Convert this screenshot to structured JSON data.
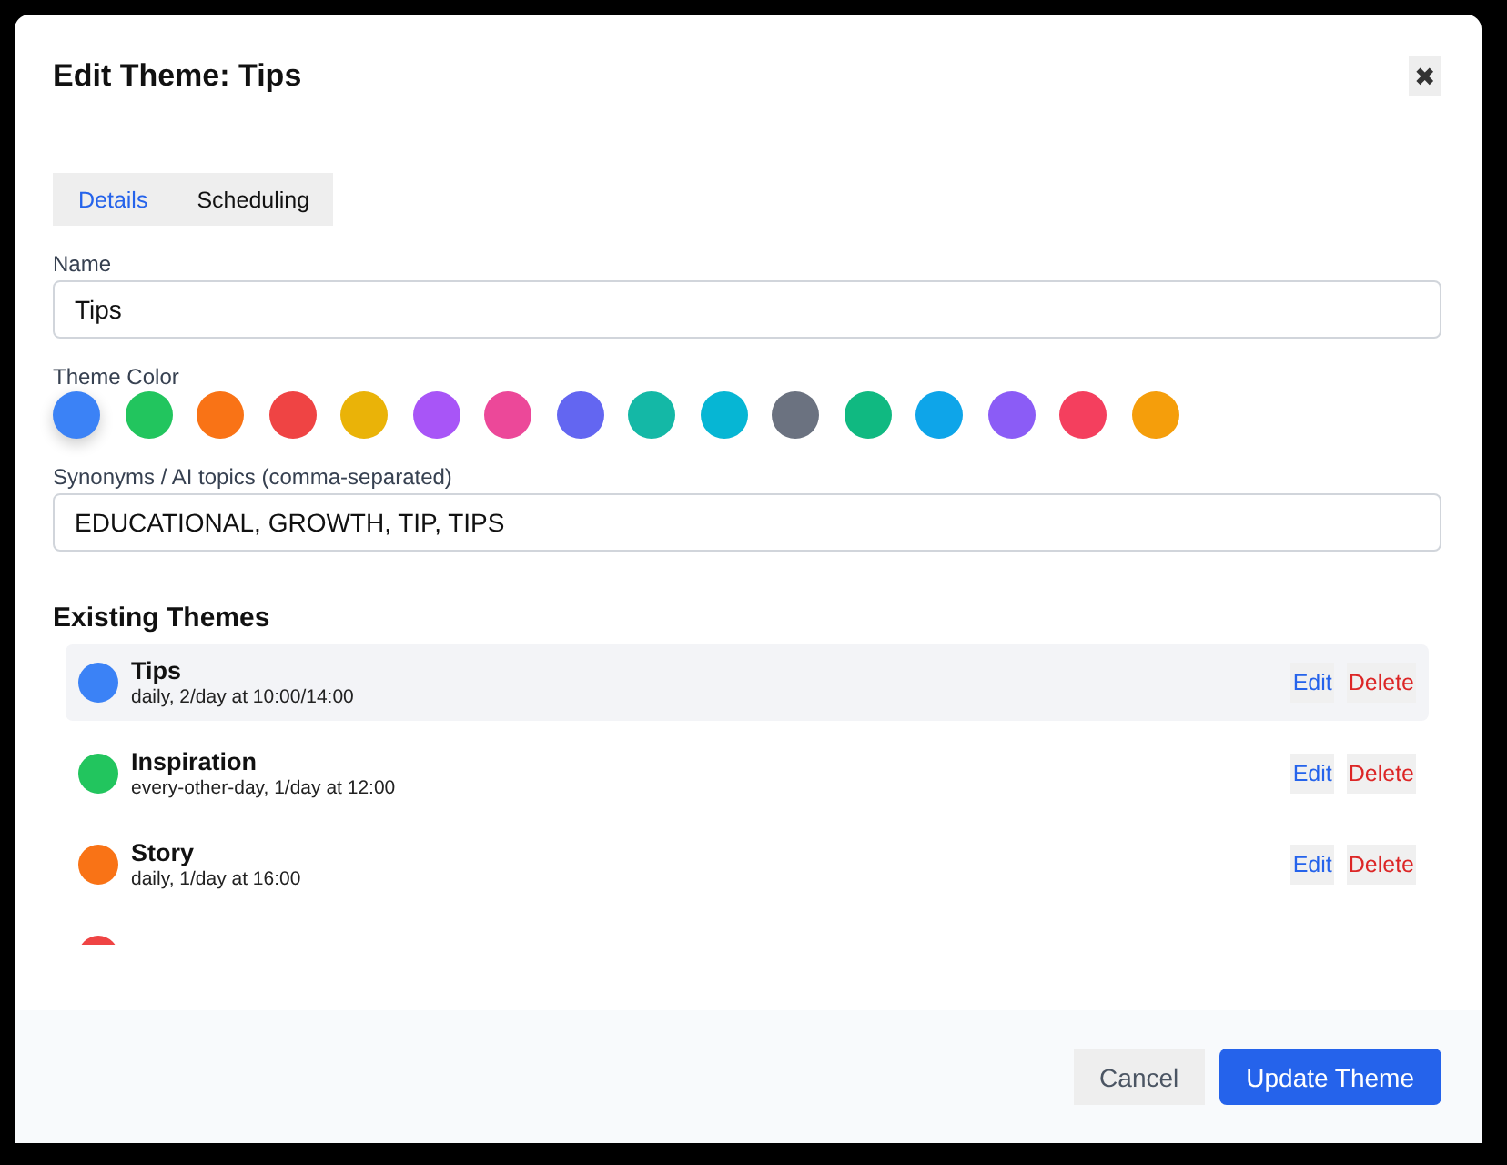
{
  "dialog": {
    "title": "Edit Theme: Tips",
    "close": "✖"
  },
  "tabs": [
    {
      "label": "Details",
      "selected": true
    },
    {
      "label": "Scheduling",
      "selected": false
    }
  ],
  "name_field": {
    "label": "Name",
    "value": "Tips"
  },
  "theme_color": {
    "label": "Theme Color",
    "swatches": [
      {
        "color": "#3b82f6",
        "selected": true
      },
      {
        "color": "#22c55e",
        "selected": false
      },
      {
        "color": "#f97316",
        "selected": false
      },
      {
        "color": "#ef4444",
        "selected": false
      },
      {
        "color": "#eab308",
        "selected": false
      },
      {
        "color": "#a855f7",
        "selected": false
      },
      {
        "color": "#ec4899",
        "selected": false
      },
      {
        "color": "#6366f1",
        "selected": false
      },
      {
        "color": "#14b8a6",
        "selected": false
      },
      {
        "color": "#06b6d4",
        "selected": false
      },
      {
        "color": "#6b7280",
        "selected": false
      },
      {
        "color": "#10b981",
        "selected": false
      },
      {
        "color": "#0ea5e9",
        "selected": false
      },
      {
        "color": "#8b5cf6",
        "selected": false
      },
      {
        "color": "#f43f5e",
        "selected": false
      },
      {
        "color": "#f59e0b",
        "selected": false
      }
    ]
  },
  "synonyms_field": {
    "label": "Synonyms / AI topics (comma-separated)",
    "value": "EDUCATIONAL, GROWTH, TIP, TIPS"
  },
  "existing_themes": {
    "heading": "Existing Themes",
    "items": [
      {
        "name": "Tips",
        "schedule": "daily, 2/day at 10:00/14:00",
        "color": "#3b82f6",
        "selected": true,
        "edit": "Edit",
        "delete": "Delete"
      },
      {
        "name": "Inspiration",
        "schedule": "every-other-day, 1/day at 12:00",
        "color": "#22c55e",
        "selected": false,
        "edit": "Edit",
        "delete": "Delete"
      },
      {
        "name": "Story",
        "schedule": "daily, 1/day at 16:00",
        "color": "#f97316",
        "selected": false,
        "edit": "Edit",
        "delete": "Delete"
      },
      {
        "color": "#ef4444",
        "selected": false
      }
    ]
  },
  "footer": {
    "cancel": "Cancel",
    "submit": "Update Theme"
  }
}
